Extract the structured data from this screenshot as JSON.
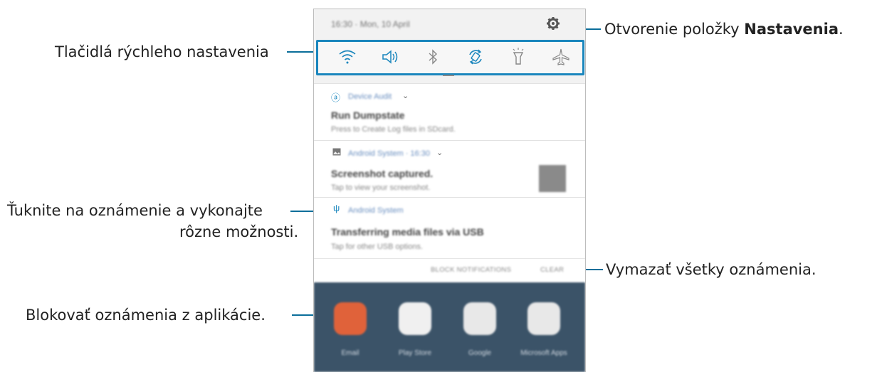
{
  "callouts": {
    "settings_prefix": "Otvorenie položky ",
    "settings_bold": "Nastavenia",
    "settings_suffix": ".",
    "quick_settings": "Tlačidlá rýchleho nastavenia",
    "tap_notification_line1": "Ťuknite na oznámenie a vykonajte",
    "tap_notification_line2": "rôzne možnosti.",
    "clear_all": "Vymazať všetky oznámenia.",
    "block_notifications": "Blokovať oznámenia z aplikácie."
  },
  "status_bar": {
    "text": "16:30 · Mon, 10 April"
  },
  "quick_settings_icons": [
    "wifi-icon",
    "sound-icon",
    "bluetooth-icon",
    "auto-rotate-icon",
    "flashlight-icon",
    "airplane-icon"
  ],
  "notifications": [
    {
      "app": "Device Audit",
      "title": "Run Dumpstate",
      "text": "Press to Create Log files in SDcard.",
      "icon": "samsung-a-icon"
    },
    {
      "app": "Android System · 16:30",
      "title": "Screenshot captured.",
      "text": "Tap to view your screenshot.",
      "icon": "image-icon"
    },
    {
      "app": "Android System",
      "title": "Transferring media files via USB",
      "text": "Tap for other USB options.",
      "icon": "usb-icon"
    }
  ],
  "actions": {
    "block": "BLOCK NOTIFICATIONS",
    "clear": "CLEAR"
  },
  "home_apps": [
    {
      "label": "Email",
      "color": "#e0623a"
    },
    {
      "label": "Play Store",
      "color": "#f0f0f0"
    },
    {
      "label": "Google",
      "color": "#e8e8e8"
    },
    {
      "label": "Microsoft Apps",
      "color": "#e8e8e8"
    }
  ],
  "colors": {
    "accent": "#1a86bd",
    "callout_line": "#0a6e9a",
    "home_bg": "#3b5368"
  }
}
